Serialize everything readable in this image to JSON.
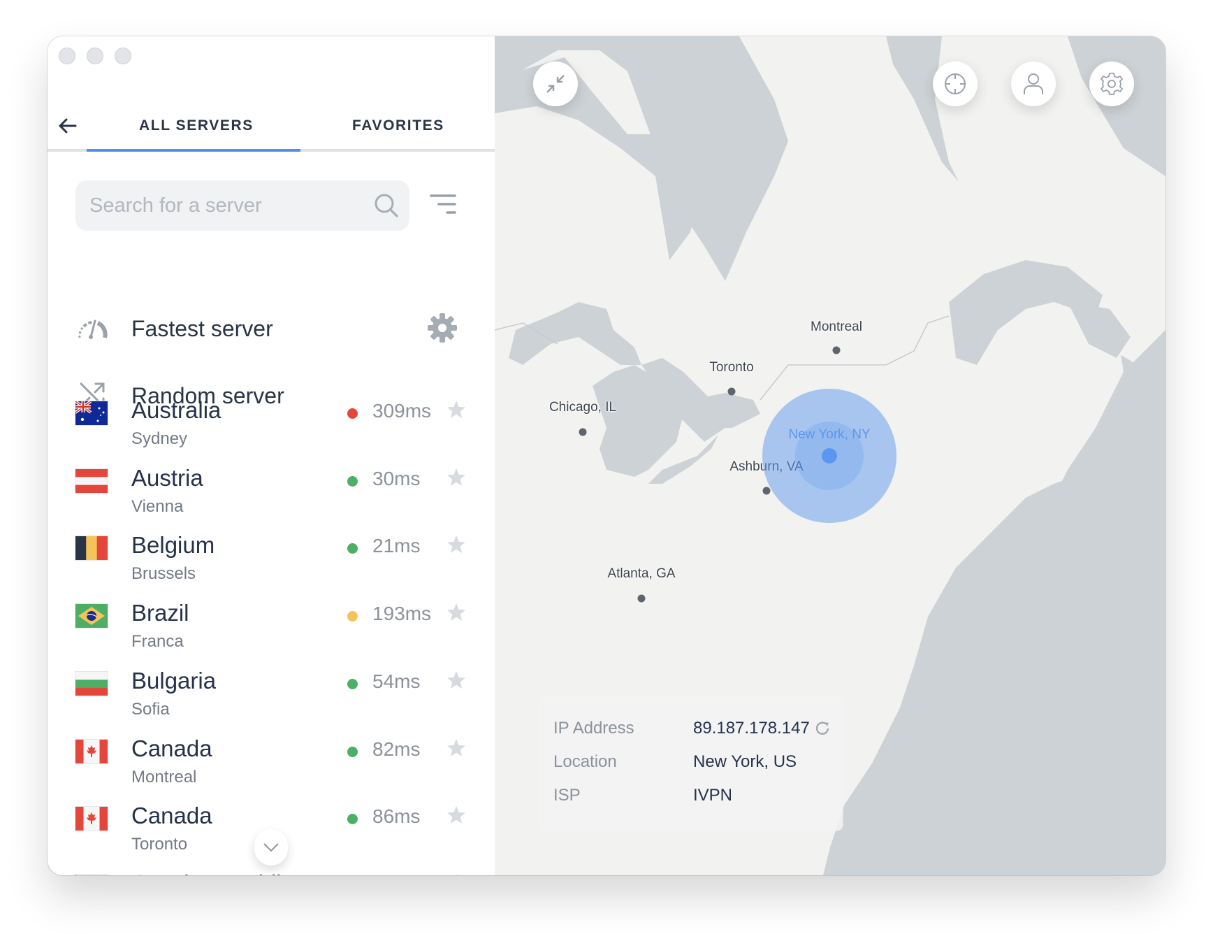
{
  "window": {
    "controls": [
      "close",
      "minimize",
      "zoom"
    ]
  },
  "tabs": {
    "back_icon": "arrow-left-icon",
    "items": [
      {
        "label": "ALL SERVERS",
        "active": true
      },
      {
        "label": "FAVORITES",
        "active": false
      }
    ]
  },
  "search": {
    "placeholder": "Search for a server",
    "value": "",
    "icon": "search-icon",
    "filter_icon": "filter-icon"
  },
  "special": {
    "fastest": {
      "label": "Fastest server",
      "icon": "speedometer-icon",
      "settings_icon": "gear-icon"
    },
    "random": {
      "label": "Random server",
      "icon": "shuffle-icon"
    }
  },
  "status_colors": {
    "good": "#4caf63",
    "medium": "#f5c35a",
    "bad": "#e5463b"
  },
  "servers": [
    {
      "country": "Australia",
      "city": "Sydney",
      "ping": "309ms",
      "status": "bad",
      "flag": "au",
      "favorite": false
    },
    {
      "country": "Austria",
      "city": "Vienna",
      "ping": "30ms",
      "status": "good",
      "flag": "at",
      "favorite": false
    },
    {
      "country": "Belgium",
      "city": "Brussels",
      "ping": "21ms",
      "status": "good",
      "flag": "be",
      "favorite": false
    },
    {
      "country": "Brazil",
      "city": "Franca",
      "ping": "193ms",
      "status": "medium",
      "flag": "br",
      "favorite": false
    },
    {
      "country": "Bulgaria",
      "city": "Sofia",
      "ping": "54ms",
      "status": "good",
      "flag": "bg",
      "favorite": false
    },
    {
      "country": "Canada",
      "city": "Montreal",
      "ping": "82ms",
      "status": "good",
      "flag": "ca",
      "favorite": false
    },
    {
      "country": "Canada",
      "city": "Toronto",
      "ping": "86ms",
      "status": "good",
      "flag": "ca",
      "favorite": false
    },
    {
      "country": "Czech Republic",
      "city": "",
      "ping": "",
      "status": "",
      "flag": "cz",
      "favorite": false
    }
  ],
  "scroll_down_icon": "chevron-down-icon",
  "map": {
    "buttons": {
      "compress": "compress-icon",
      "locate": "crosshair-icon",
      "account": "user-icon",
      "settings": "gear-icon"
    },
    "cities": [
      {
        "name": "Montreal"
      },
      {
        "name": "Toronto"
      },
      {
        "name": "Chicago, IL"
      },
      {
        "name": "Ashburn, VA"
      },
      {
        "name": "Atlanta, GA"
      }
    ],
    "connected_city": "New York, NY",
    "accent": "#5b97ee"
  },
  "info": {
    "ip_label": "IP Address",
    "ip_value": "89.187.178.147",
    "location_label": "Location",
    "location_value": "New York, US",
    "isp_label": "ISP",
    "isp_value": "IVPN"
  }
}
